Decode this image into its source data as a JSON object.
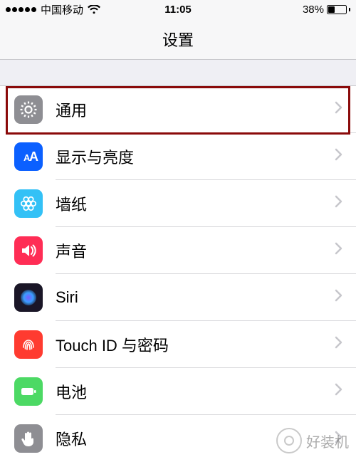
{
  "status": {
    "carrier": "中国移动",
    "time": "11:05",
    "battery_pct": "38%",
    "battery_level": 0.38
  },
  "nav": {
    "title": "设置"
  },
  "rows": [
    {
      "key": "general",
      "label": "通用",
      "icon": "gear-icon",
      "bg": "#8e8e93",
      "fg": "#ffffff"
    },
    {
      "key": "display",
      "label": "显示与亮度",
      "icon": "text-size-icon",
      "bg": "#0b60ff",
      "fg": "#ffffff"
    },
    {
      "key": "wallpaper",
      "label": "墙纸",
      "icon": "flower-icon",
      "bg": "#33c1f6",
      "fg": "#ffffff"
    },
    {
      "key": "sound",
      "label": "声音",
      "icon": "speaker-icon",
      "bg": "#ff2d55",
      "fg": "#ffffff"
    },
    {
      "key": "siri",
      "label": "Siri",
      "icon": "siri-icon",
      "bg": "#1a1627",
      "fg": "#ffffff"
    },
    {
      "key": "touchid",
      "label": "Touch ID 与密码",
      "icon": "fingerprint-icon",
      "bg": "#ff3b30",
      "fg": "#ffffff"
    },
    {
      "key": "battery",
      "label": "电池",
      "icon": "battery-icon",
      "bg": "#4cd964",
      "fg": "#ffffff"
    },
    {
      "key": "privacy",
      "label": "隐私",
      "icon": "hand-icon",
      "bg": "#8e8e93",
      "fg": "#ffffff"
    }
  ],
  "highlighted_row": "general",
  "watermark": {
    "text": "好装机"
  }
}
